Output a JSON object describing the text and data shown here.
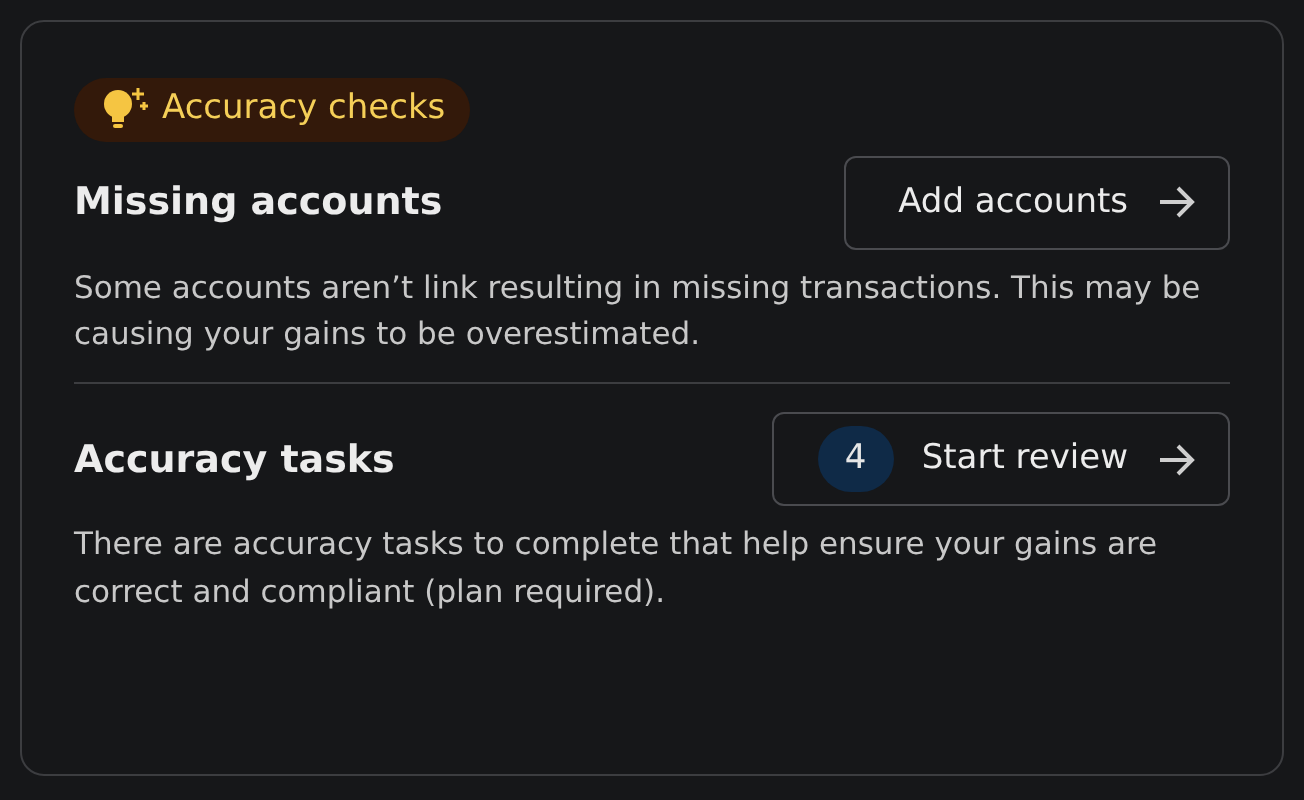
{
  "badge": {
    "label": "Accuracy checks"
  },
  "sections": [
    {
      "title": "Missing accounts",
      "button": {
        "label": "Add accounts"
      },
      "description": "Some accounts aren’t link resulting in missing transactions. This may be causing your gains to be overestimated."
    },
    {
      "title": "Accuracy tasks",
      "button": {
        "label": "Start review",
        "count": "4"
      },
      "description": "There are accuracy tasks to complete that help ensure your gains are correct and compliant (plan required)."
    }
  ]
}
